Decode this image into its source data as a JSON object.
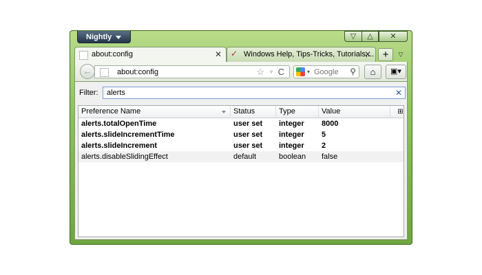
{
  "app": {
    "menu_button": "Nightly"
  },
  "window_controls": {
    "minimize": "▽",
    "maximize": "△",
    "close": "✕"
  },
  "tabs": [
    {
      "title": "about:config",
      "active": true,
      "close": "✕"
    },
    {
      "title": "Windows Help, Tips-Tricks, Tutorials,...",
      "active": false,
      "close": "✕"
    }
  ],
  "tab_add": "+",
  "tab_list": "▽",
  "navbar": {
    "back": "←",
    "url": "about:config",
    "star": "☆",
    "dropdown": "▿",
    "reload": "C",
    "search_placeholder": "Google",
    "search_dropdown": "▾",
    "magnifier": "⚲",
    "home": "⌂",
    "bookmarks": "▣▾"
  },
  "filter": {
    "label": "Filter:",
    "value": "alerts",
    "clear": "✕"
  },
  "columns": [
    "Preference Name",
    "Status",
    "Type",
    "Value"
  ],
  "column_picker": "⊞",
  "rows": [
    {
      "name": "alerts.totalOpenTime",
      "status": "user set",
      "type": "integer",
      "value": "8000"
    },
    {
      "name": "alerts.slideIncrementTime",
      "status": "user set",
      "type": "integer",
      "value": "5"
    },
    {
      "name": "alerts.slideIncrement",
      "status": "user set",
      "type": "integer",
      "value": "2"
    },
    {
      "name": "alerts.disableSlidingEffect",
      "status": "default",
      "type": "boolean",
      "value": "false"
    }
  ]
}
